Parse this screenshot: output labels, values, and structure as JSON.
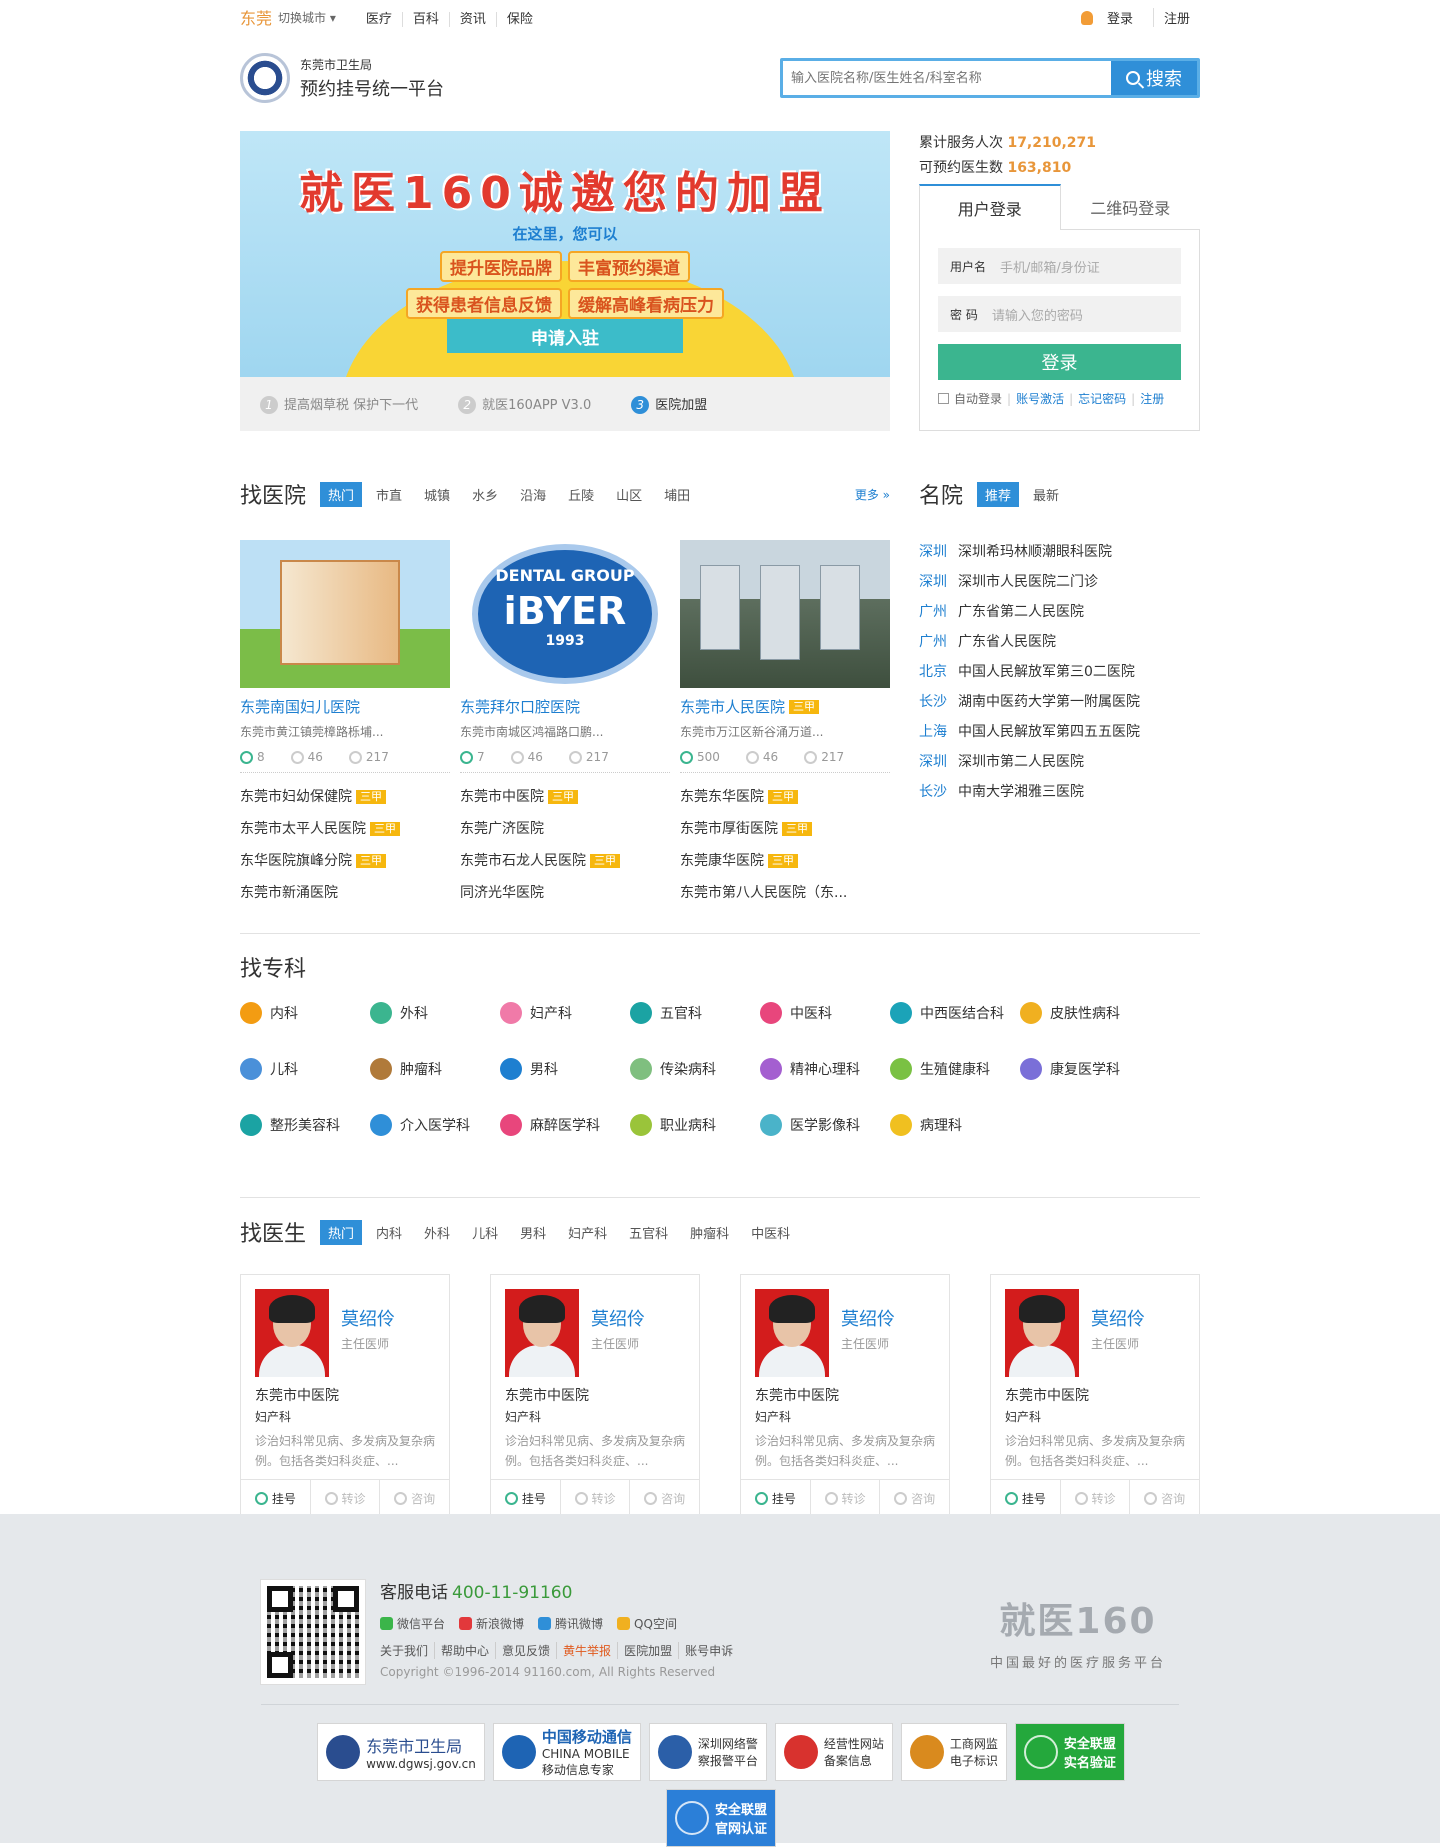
{
  "topbar": {
    "city": "东莞",
    "switch": "切换城市",
    "nav": [
      "医疗",
      "百科",
      "资讯",
      "保险"
    ],
    "login": "登录",
    "register": "注册"
  },
  "header": {
    "org": "东莞市卫生局",
    "title": "预约挂号统一平台",
    "search_placeholder": "输入医院名称/医生姓名/科室名称",
    "search_button": "搜索"
  },
  "banner": {
    "title": "就医160诚邀您的加盟",
    "subtitle": "在这里，您可以",
    "tags1": [
      "提升医院品牌",
      "丰富预约渠道"
    ],
    "tags2": [
      "获得患者信息反馈",
      "缓解高峰看病压力"
    ],
    "button": "申请入驻",
    "slides": [
      {
        "n": "1",
        "label": "提高烟草税 保护下一代"
      },
      {
        "n": "2",
        "label": "就医160APP V3.0"
      },
      {
        "n": "3",
        "label": "医院加盟"
      }
    ]
  },
  "stats": {
    "served_label": "累计服务人次",
    "served": "17,210,271",
    "doctors_label": "可预约医生数",
    "doctors": "163,810"
  },
  "login": {
    "tab_user": "用户登录",
    "tab_qr": "二维码登录",
    "user_label": "用户名",
    "user_ph": "手机/邮箱/身份证",
    "pwd_label": "密  码",
    "pwd_ph": "请输入您的密码",
    "button": "登录",
    "auto": "自动登录",
    "activate": "账号激活",
    "forgot": "忘记密码",
    "register": "注册"
  },
  "hospitals": {
    "title": "找医院",
    "tabs": [
      "热门",
      "市直",
      "城镇",
      "水乡",
      "沿海",
      "丘陵",
      "山区",
      "埔田"
    ],
    "more": "更多 »",
    "cards": [
      {
        "name": "东莞南国妇儿医院",
        "tag": "",
        "addr": "东莞市黄江镇莞樟路栎埔...",
        "s1": "8",
        "s2": "46",
        "s3": "217"
      },
      {
        "name": "东莞拜尔口腔医院",
        "tag": "",
        "addr": "东莞市南城区鸿福路口鹏...",
        "s1": "7",
        "s2": "46",
        "s3": "217",
        "logo1": "DENTAL GROUP",
        "logo2": "iBYER",
        "logo3": "1993"
      },
      {
        "name": "东莞市人民医院",
        "tag": "三甲",
        "addr": "东莞市万江区新谷涌万道...",
        "s1": "500",
        "s2": "46",
        "s3": "217"
      }
    ],
    "col1": [
      {
        "name": "东莞市妇幼保健院",
        "tag": "三甲"
      },
      {
        "name": "东莞市太平人民医院",
        "tag": "三甲"
      },
      {
        "name": "东华医院旗峰分院",
        "tag": "三甲"
      },
      {
        "name": "东莞市新涌医院",
        "tag": ""
      }
    ],
    "col2": [
      {
        "name": "东莞市中医院",
        "tag": "三甲"
      },
      {
        "name": "东莞广济医院",
        "tag": ""
      },
      {
        "name": "东莞市石龙人民医院",
        "tag": "三甲"
      },
      {
        "name": "同济光华医院",
        "tag": ""
      }
    ],
    "col3": [
      {
        "name": "东莞东华医院",
        "tag": "三甲"
      },
      {
        "name": "东莞市厚街医院",
        "tag": "三甲"
      },
      {
        "name": "东莞康华医院",
        "tag": "三甲"
      },
      {
        "name": "东莞市第八人民医院（东...",
        "tag": ""
      }
    ]
  },
  "famous": {
    "title": "名院",
    "tabs": [
      "推荐",
      "最新"
    ],
    "items": [
      {
        "city": "深圳",
        "name": "深圳希玛林顺潮眼科医院"
      },
      {
        "city": "深圳",
        "name": "深圳市人民医院二门诊"
      },
      {
        "city": "广州",
        "name": "广东省第二人民医院"
      },
      {
        "city": "广州",
        "name": "广东省人民医院"
      },
      {
        "city": "北京",
        "name": "中国人民解放军第三0二医院"
      },
      {
        "city": "长沙",
        "name": "湖南中医药大学第一附属医院"
      },
      {
        "city": "上海",
        "name": "中国人民解放军第四五五医院"
      },
      {
        "city": "深圳",
        "name": "深圳市第二人民医院"
      },
      {
        "city": "长沙",
        "name": "中南大学湘雅三医院"
      }
    ]
  },
  "departments": {
    "title": "找专科",
    "items": [
      {
        "name": "内科",
        "color": "#f39c12"
      },
      {
        "name": "外科",
        "color": "#3bb58f"
      },
      {
        "name": "妇产科",
        "color": "#f07aa8"
      },
      {
        "name": "五官科",
        "color": "#1ba3a3"
      },
      {
        "name": "中医科",
        "color": "#e8467c"
      },
      {
        "name": "中西医结合科",
        "color": "#1ba3b8"
      },
      {
        "name": "皮肤性病科",
        "color": "#f0b020"
      },
      {
        "name": "儿科",
        "color": "#4a90d9"
      },
      {
        "name": "肿瘤科",
        "color": "#b07a3a"
      },
      {
        "name": "男科",
        "color": "#1e7fd0"
      },
      {
        "name": "传染病科",
        "color": "#7fbf7f"
      },
      {
        "name": "精神心理科",
        "color": "#a45fd0"
      },
      {
        "name": "生殖健康科",
        "color": "#7ac143"
      },
      {
        "name": "康复医学科",
        "color": "#7a6fd8"
      },
      {
        "name": "整形美容科",
        "color": "#1ba3a3"
      },
      {
        "name": "介入医学科",
        "color": "#2f8fd8"
      },
      {
        "name": "麻醉医学科",
        "color": "#e8467c"
      },
      {
        "name": "职业病科",
        "color": "#9ac43a"
      },
      {
        "name": "医学影像科",
        "color": "#4ab3c9"
      },
      {
        "name": "病理科",
        "color": "#f0c020"
      }
    ]
  },
  "doctors": {
    "title": "找医生",
    "tabs": [
      "热门",
      "内科",
      "外科",
      "儿科",
      "男科",
      "妇产科",
      "五官科",
      "肿瘤科",
      "中医科"
    ],
    "items": [
      {
        "name": "莫绍伶",
        "title": "主任医师",
        "hospital": "东莞市中医院",
        "dept": "妇产科",
        "desc": "诊治妇科常见病、多发病及复杂病例。包括各类妇科炎症、...",
        "b1": "挂号",
        "b2": "转诊",
        "b3": "咨询"
      },
      {
        "name": "莫绍伶",
        "title": "主任医师",
        "hospital": "东莞市中医院",
        "dept": "妇产科",
        "desc": "诊治妇科常见病、多发病及复杂病例。包括各类妇科炎症、...",
        "b1": "挂号",
        "b2": "转诊",
        "b3": "咨询"
      },
      {
        "name": "莫绍伶",
        "title": "主任医师",
        "hospital": "东莞市中医院",
        "dept": "妇产科",
        "desc": "诊治妇科常见病、多发病及复杂病例。包括各类妇科炎症、...",
        "b1": "挂号",
        "b2": "转诊",
        "b3": "咨询"
      },
      {
        "name": "莫绍伶",
        "title": "主任医师",
        "hospital": "东莞市中医院",
        "dept": "妇产科",
        "desc": "诊治妇科常见病、多发病及复杂病例。包括各类妇科炎症、...",
        "b1": "挂号",
        "b2": "转诊",
        "b3": "咨询"
      }
    ]
  },
  "footer": {
    "tel_label": "客服电话",
    "tel": "400-11-91160",
    "social": [
      {
        "name": "微信平台",
        "color": "#3bb54a"
      },
      {
        "name": "新浪微博",
        "color": "#e2383b"
      },
      {
        "name": "腾讯微博",
        "color": "#2f8fd8"
      },
      {
        "name": "QQ空间",
        "color": "#f0b020"
      }
    ],
    "links": [
      "关于我们",
      "帮助中心",
      "意见反馈",
      "黄牛举报",
      "医院加盟",
      "账号申诉"
    ],
    "copyright": "Copyright ©1996-2014 91160.com, All Rights Reserved",
    "logo": "就医160",
    "slogan": "中国最好的医疗服务平台",
    "certs": [
      {
        "l1": "东莞市卫生局",
        "l2": "www.dgwsj.gov.cn"
      },
      {
        "l1": "中国移动通信",
        "l2": "CHINA MOBILE",
        "l3": "移动信息专家"
      },
      {
        "l1": "深圳网络警",
        "l2": "察报警平台"
      },
      {
        "l1": "经营性网站",
        "l2": "备案信息"
      },
      {
        "l1": "工商网监",
        "l2": "电子标识"
      },
      {
        "l1": "安全联盟",
        "l2": "实名验证"
      },
      {
        "l1": "安全联盟",
        "l2": "官网认证"
      }
    ]
  }
}
